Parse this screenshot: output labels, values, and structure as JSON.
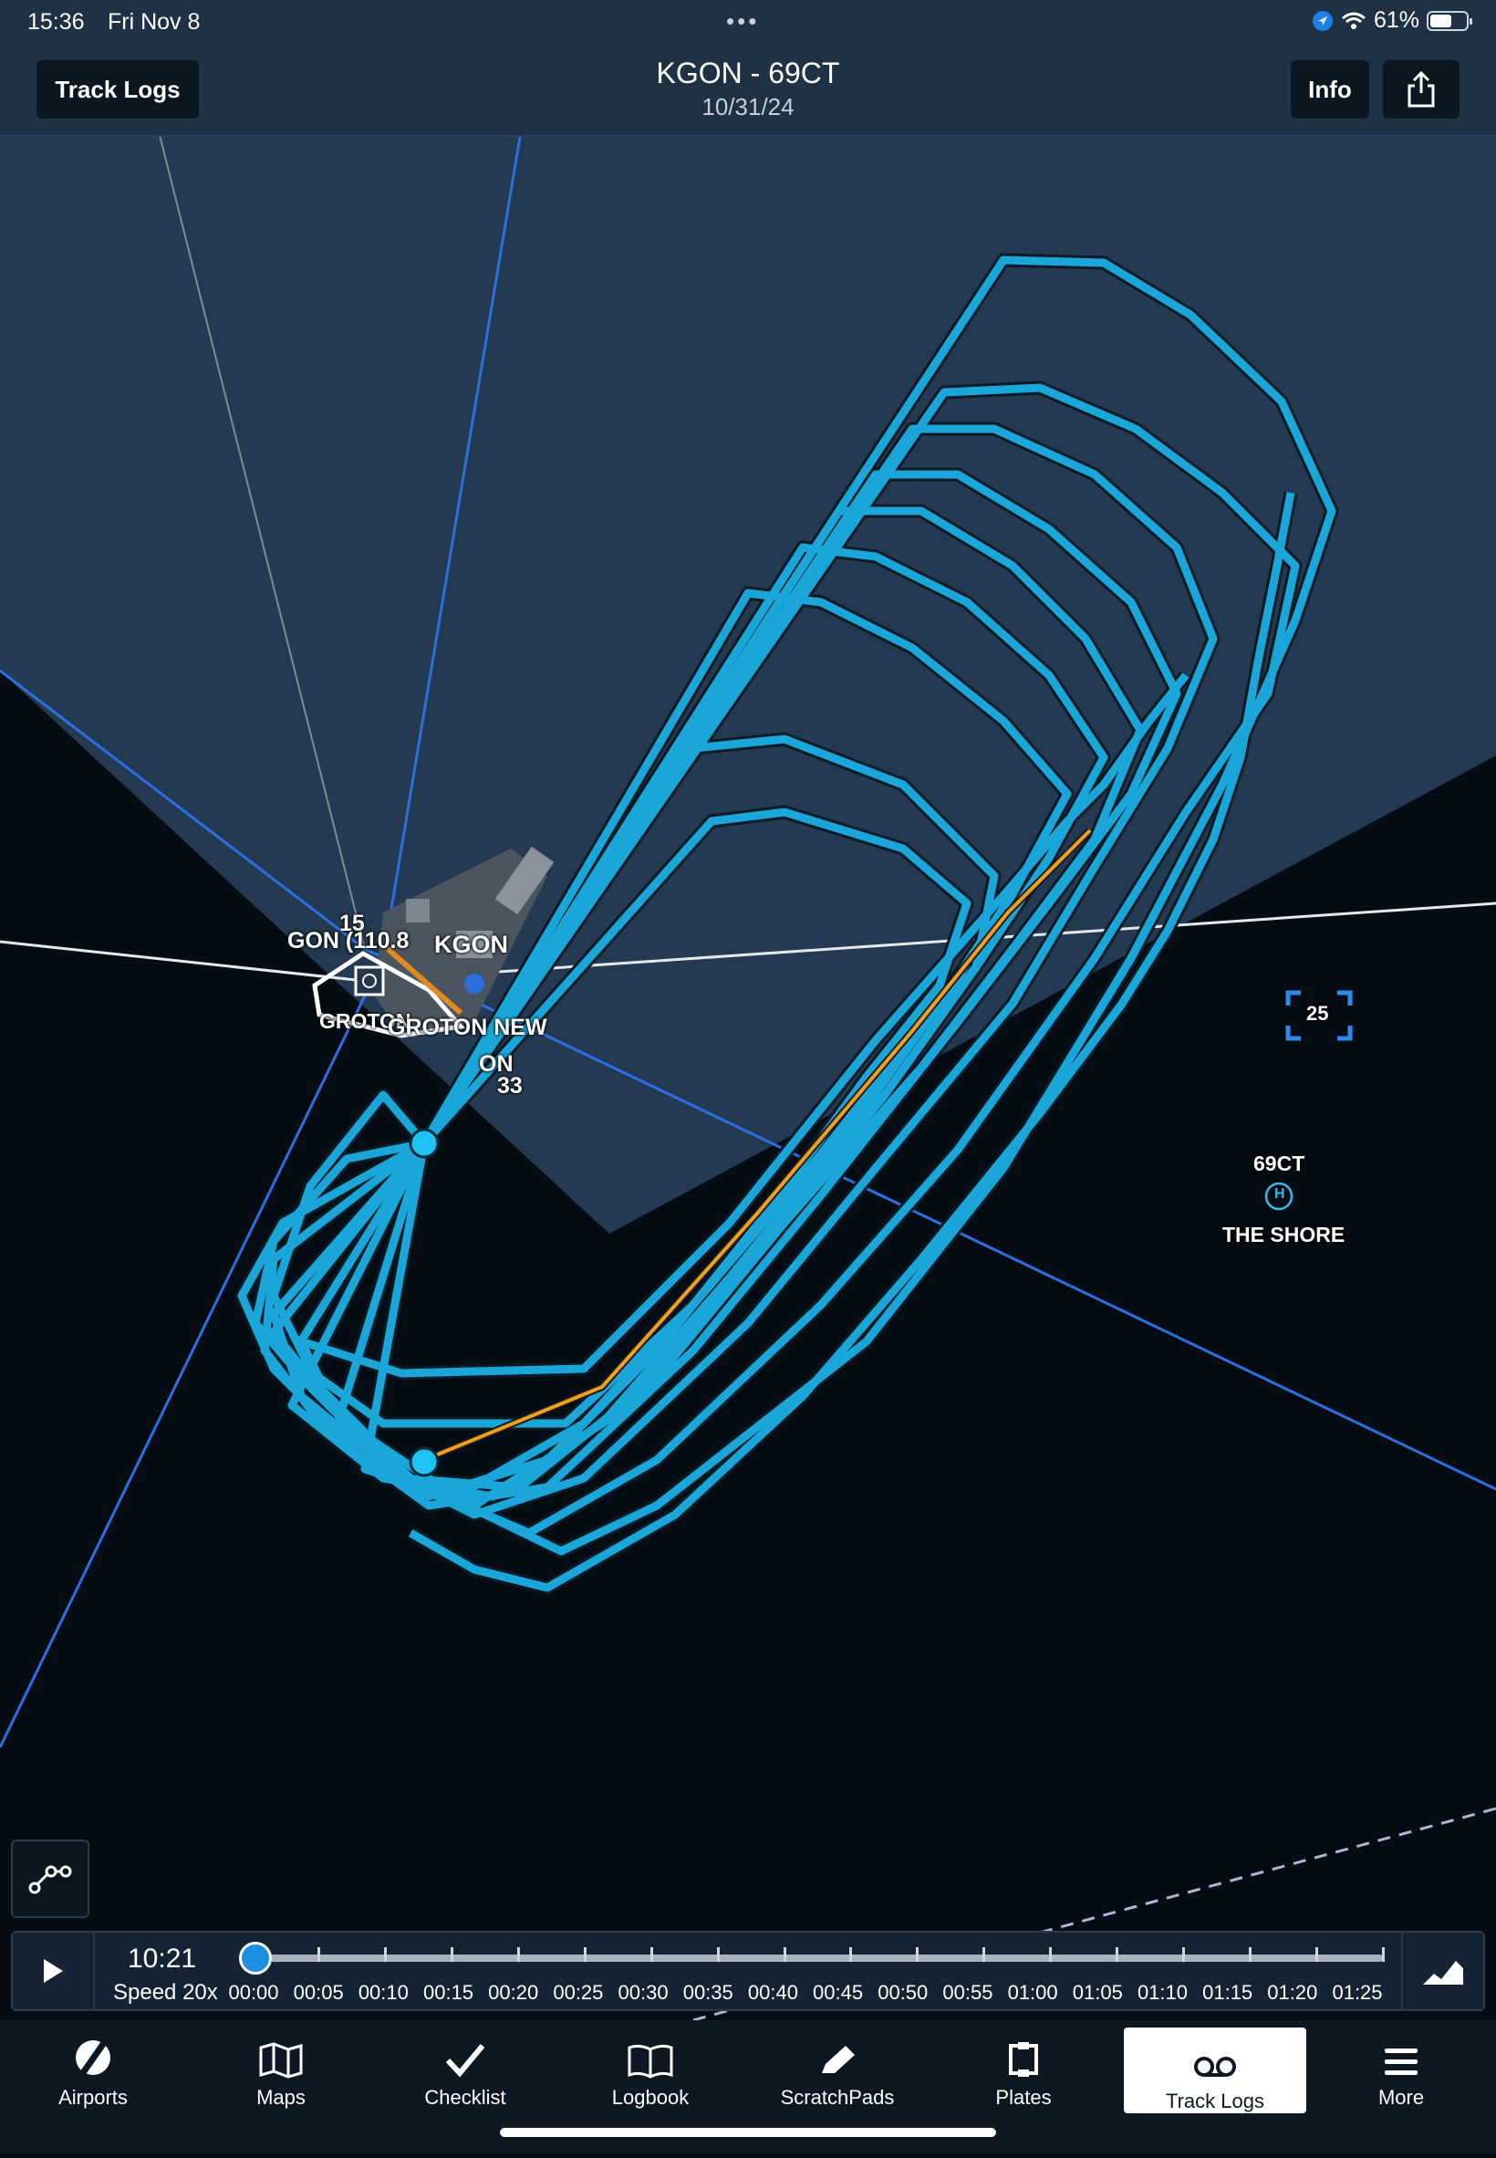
{
  "status_bar": {
    "time": "15:36",
    "date": "Fri Nov 8",
    "battery": "61%",
    "battery_level": 0.61
  },
  "header": {
    "back_label": "Track Logs",
    "title": "KGON - 69CT",
    "subtitle": "10/31/24",
    "info_label": "Info"
  },
  "map": {
    "labels": {
      "runway_15": "15",
      "vor": "GON (110.8",
      "airport": "KGON",
      "groton1": "GROTON",
      "groton2": "GROTON NEW",
      "groton3": "ON",
      "runway_33": "33",
      "heliport_id": "69CT",
      "heliport_name": "THE SHORE",
      "heliport_symbol": "H",
      "traffic_box": "25"
    },
    "colors": {
      "track": "#1aa6d8",
      "track_highlight": "#f0a020",
      "airspace": "#233a52",
      "radial": "#2e6fe0"
    }
  },
  "playback": {
    "time": "10:21",
    "speed": "Speed 20x",
    "position_fraction": 0.0,
    "ticks": [
      "00:00",
      "00:05",
      "00:10",
      "00:15",
      "00:20",
      "00:25",
      "00:30",
      "00:35",
      "00:40",
      "00:45",
      "00:50",
      "00:55",
      "01:00",
      "01:05",
      "01:10",
      "01:15",
      "01:20",
      "01:25"
    ]
  },
  "tabs": [
    {
      "label": "Airports",
      "icon": "airport-icon"
    },
    {
      "label": "Maps",
      "icon": "map-icon"
    },
    {
      "label": "Checklist",
      "icon": "checkmark-icon"
    },
    {
      "label": "Logbook",
      "icon": "book-icon"
    },
    {
      "label": "ScratchPads",
      "icon": "pencil-icon"
    },
    {
      "label": "Plates",
      "icon": "plate-icon"
    },
    {
      "label": "Track Logs",
      "icon": "voicemail-icon",
      "active": true
    },
    {
      "label": "More",
      "icon": "hamburger-icon"
    }
  ]
}
